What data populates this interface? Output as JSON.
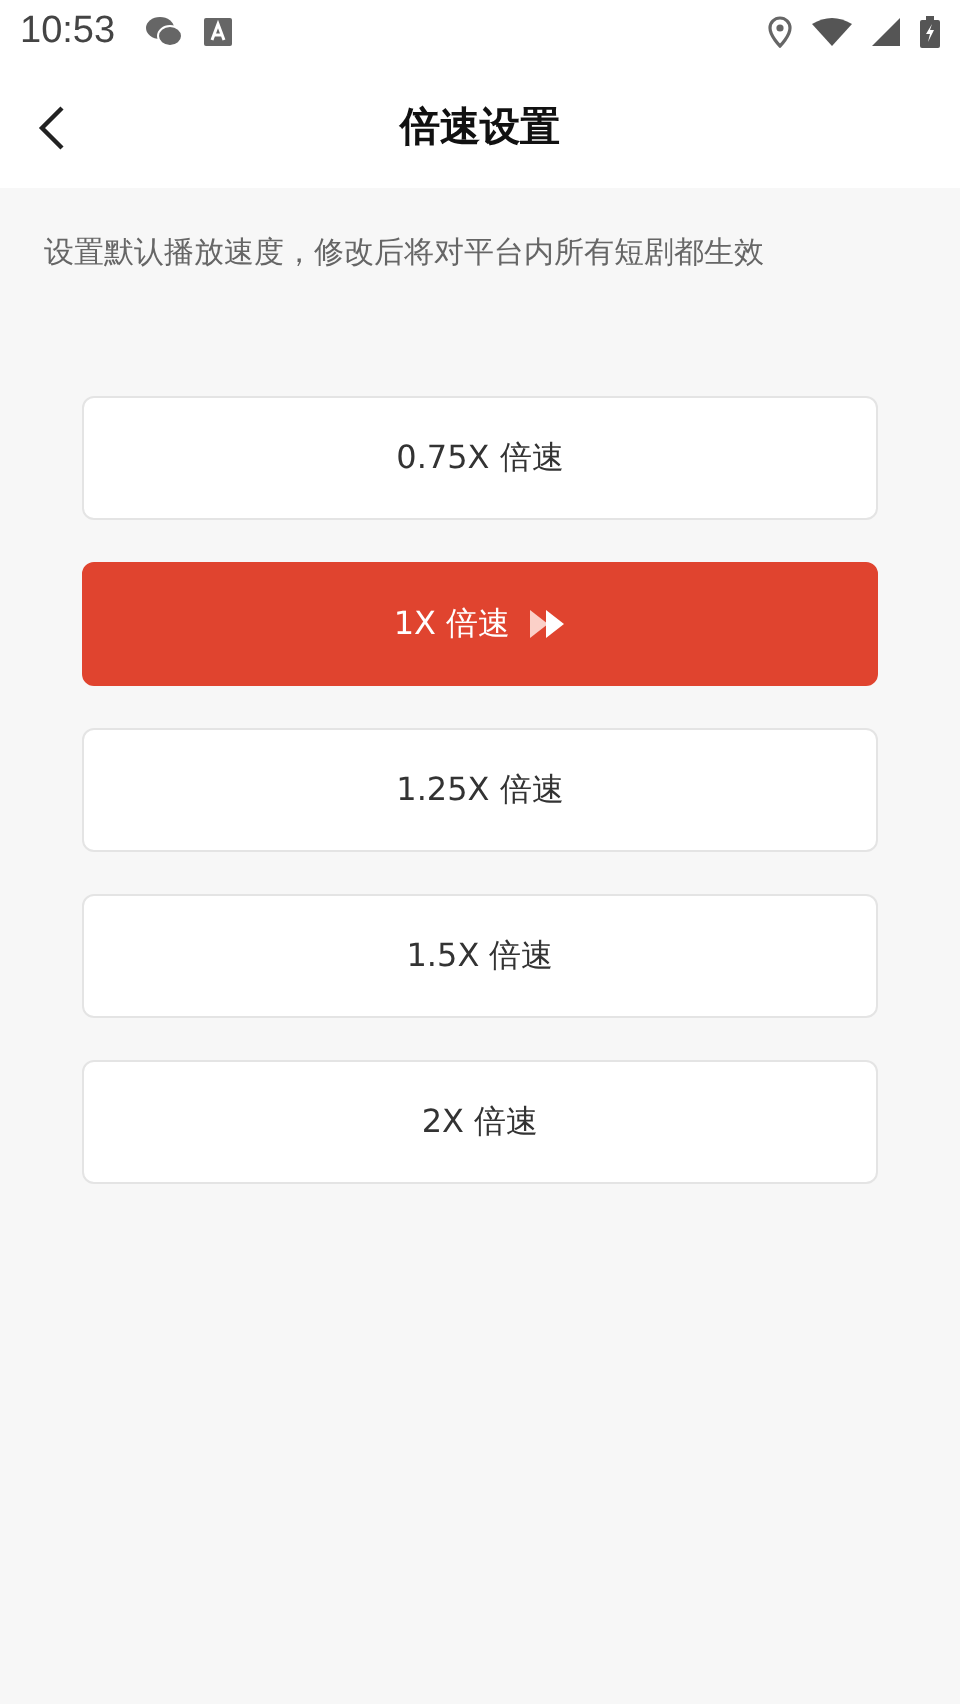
{
  "status_bar": {
    "time": "10:53"
  },
  "header": {
    "title": "倍速设置"
  },
  "description": "设置默认播放速度，修改后将对平台内所有短剧都生效",
  "speeds": [
    {
      "label": "0.75X 倍速",
      "selected": false
    },
    {
      "label": "1X 倍速",
      "selected": true
    },
    {
      "label": "1.25X 倍速",
      "selected": false
    },
    {
      "label": "1.5X 倍速",
      "selected": false
    },
    {
      "label": "2X 倍速",
      "selected": false
    }
  ]
}
